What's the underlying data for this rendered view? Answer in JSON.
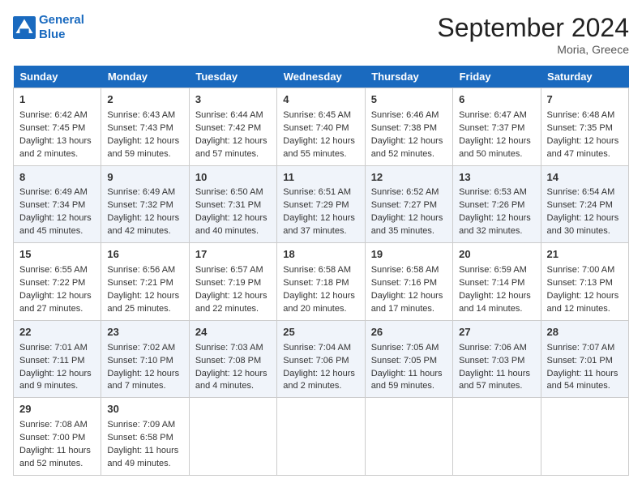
{
  "header": {
    "logo_line1": "General",
    "logo_line2": "Blue",
    "month_title": "September 2024",
    "location": "Moria, Greece"
  },
  "weekdays": [
    "Sunday",
    "Monday",
    "Tuesday",
    "Wednesday",
    "Thursday",
    "Friday",
    "Saturday"
  ],
  "weeks": [
    [
      {
        "day": "1",
        "lines": [
          "Sunrise: 6:42 AM",
          "Sunset: 7:45 PM",
          "Daylight: 13 hours",
          "and 2 minutes."
        ]
      },
      {
        "day": "2",
        "lines": [
          "Sunrise: 6:43 AM",
          "Sunset: 7:43 PM",
          "Daylight: 12 hours",
          "and 59 minutes."
        ]
      },
      {
        "day": "3",
        "lines": [
          "Sunrise: 6:44 AM",
          "Sunset: 7:42 PM",
          "Daylight: 12 hours",
          "and 57 minutes."
        ]
      },
      {
        "day": "4",
        "lines": [
          "Sunrise: 6:45 AM",
          "Sunset: 7:40 PM",
          "Daylight: 12 hours",
          "and 55 minutes."
        ]
      },
      {
        "day": "5",
        "lines": [
          "Sunrise: 6:46 AM",
          "Sunset: 7:38 PM",
          "Daylight: 12 hours",
          "and 52 minutes."
        ]
      },
      {
        "day": "6",
        "lines": [
          "Sunrise: 6:47 AM",
          "Sunset: 7:37 PM",
          "Daylight: 12 hours",
          "and 50 minutes."
        ]
      },
      {
        "day": "7",
        "lines": [
          "Sunrise: 6:48 AM",
          "Sunset: 7:35 PM",
          "Daylight: 12 hours",
          "and 47 minutes."
        ]
      }
    ],
    [
      {
        "day": "8",
        "lines": [
          "Sunrise: 6:49 AM",
          "Sunset: 7:34 PM",
          "Daylight: 12 hours",
          "and 45 minutes."
        ]
      },
      {
        "day": "9",
        "lines": [
          "Sunrise: 6:49 AM",
          "Sunset: 7:32 PM",
          "Daylight: 12 hours",
          "and 42 minutes."
        ]
      },
      {
        "day": "10",
        "lines": [
          "Sunrise: 6:50 AM",
          "Sunset: 7:31 PM",
          "Daylight: 12 hours",
          "and 40 minutes."
        ]
      },
      {
        "day": "11",
        "lines": [
          "Sunrise: 6:51 AM",
          "Sunset: 7:29 PM",
          "Daylight: 12 hours",
          "and 37 minutes."
        ]
      },
      {
        "day": "12",
        "lines": [
          "Sunrise: 6:52 AM",
          "Sunset: 7:27 PM",
          "Daylight: 12 hours",
          "and 35 minutes."
        ]
      },
      {
        "day": "13",
        "lines": [
          "Sunrise: 6:53 AM",
          "Sunset: 7:26 PM",
          "Daylight: 12 hours",
          "and 32 minutes."
        ]
      },
      {
        "day": "14",
        "lines": [
          "Sunrise: 6:54 AM",
          "Sunset: 7:24 PM",
          "Daylight: 12 hours",
          "and 30 minutes."
        ]
      }
    ],
    [
      {
        "day": "15",
        "lines": [
          "Sunrise: 6:55 AM",
          "Sunset: 7:22 PM",
          "Daylight: 12 hours",
          "and 27 minutes."
        ]
      },
      {
        "day": "16",
        "lines": [
          "Sunrise: 6:56 AM",
          "Sunset: 7:21 PM",
          "Daylight: 12 hours",
          "and 25 minutes."
        ]
      },
      {
        "day": "17",
        "lines": [
          "Sunrise: 6:57 AM",
          "Sunset: 7:19 PM",
          "Daylight: 12 hours",
          "and 22 minutes."
        ]
      },
      {
        "day": "18",
        "lines": [
          "Sunrise: 6:58 AM",
          "Sunset: 7:18 PM",
          "Daylight: 12 hours",
          "and 20 minutes."
        ]
      },
      {
        "day": "19",
        "lines": [
          "Sunrise: 6:58 AM",
          "Sunset: 7:16 PM",
          "Daylight: 12 hours",
          "and 17 minutes."
        ]
      },
      {
        "day": "20",
        "lines": [
          "Sunrise: 6:59 AM",
          "Sunset: 7:14 PM",
          "Daylight: 12 hours",
          "and 14 minutes."
        ]
      },
      {
        "day": "21",
        "lines": [
          "Sunrise: 7:00 AM",
          "Sunset: 7:13 PM",
          "Daylight: 12 hours",
          "and 12 minutes."
        ]
      }
    ],
    [
      {
        "day": "22",
        "lines": [
          "Sunrise: 7:01 AM",
          "Sunset: 7:11 PM",
          "Daylight: 12 hours",
          "and 9 minutes."
        ]
      },
      {
        "day": "23",
        "lines": [
          "Sunrise: 7:02 AM",
          "Sunset: 7:10 PM",
          "Daylight: 12 hours",
          "and 7 minutes."
        ]
      },
      {
        "day": "24",
        "lines": [
          "Sunrise: 7:03 AM",
          "Sunset: 7:08 PM",
          "Daylight: 12 hours",
          "and 4 minutes."
        ]
      },
      {
        "day": "25",
        "lines": [
          "Sunrise: 7:04 AM",
          "Sunset: 7:06 PM",
          "Daylight: 12 hours",
          "and 2 minutes."
        ]
      },
      {
        "day": "26",
        "lines": [
          "Sunrise: 7:05 AM",
          "Sunset: 7:05 PM",
          "Daylight: 11 hours",
          "and 59 minutes."
        ]
      },
      {
        "day": "27",
        "lines": [
          "Sunrise: 7:06 AM",
          "Sunset: 7:03 PM",
          "Daylight: 11 hours",
          "and 57 minutes."
        ]
      },
      {
        "day": "28",
        "lines": [
          "Sunrise: 7:07 AM",
          "Sunset: 7:01 PM",
          "Daylight: 11 hours",
          "and 54 minutes."
        ]
      }
    ],
    [
      {
        "day": "29",
        "lines": [
          "Sunrise: 7:08 AM",
          "Sunset: 7:00 PM",
          "Daylight: 11 hours",
          "and 52 minutes."
        ]
      },
      {
        "day": "30",
        "lines": [
          "Sunrise: 7:09 AM",
          "Sunset: 6:58 PM",
          "Daylight: 11 hours",
          "and 49 minutes."
        ]
      },
      {
        "day": "",
        "lines": []
      },
      {
        "day": "",
        "lines": []
      },
      {
        "day": "",
        "lines": []
      },
      {
        "day": "",
        "lines": []
      },
      {
        "day": "",
        "lines": []
      }
    ]
  ]
}
